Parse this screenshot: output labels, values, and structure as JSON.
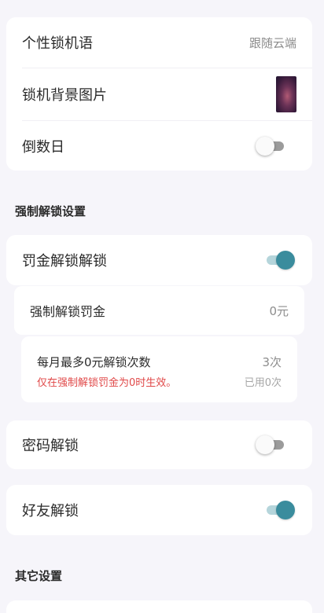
{
  "lock_settings": {
    "personal_message": {
      "label": "个性锁机语",
      "value": "跟随云端"
    },
    "background_image": {
      "label": "锁机背景图片"
    },
    "countdown_day": {
      "label": "倒数日",
      "enabled": false
    }
  },
  "force_unlock": {
    "section_title": "强制解锁设置",
    "fine_unlock": {
      "label": "罚金解锁解锁",
      "enabled": true
    },
    "fine_amount": {
      "label": "强制解锁罚金",
      "value": "0元"
    },
    "monthly_free": {
      "label": "每月最多0元解锁次数",
      "value": "3次",
      "note": "仅在强制解锁罚金为0时生效。",
      "used": "已用0次"
    }
  },
  "password_unlock": {
    "label": "密码解锁",
    "enabled": false
  },
  "friend_unlock": {
    "label": "好友解锁",
    "enabled": true
  },
  "other": {
    "section_title": "其它设置"
  },
  "colors": {
    "background": "#f6f5fa",
    "accent": "#3a8c9d",
    "warning": "#e04848"
  }
}
